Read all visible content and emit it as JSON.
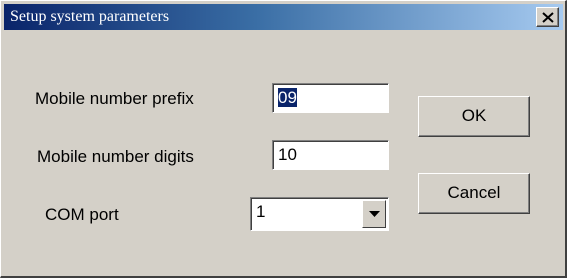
{
  "window": {
    "title": "Setup system parameters",
    "close_icon": "close-icon"
  },
  "fields": {
    "prefix": {
      "label": "Mobile number prefix",
      "value": "09"
    },
    "digits": {
      "label": "Mobile number digits",
      "value": "10"
    },
    "com_port": {
      "label": "COM port",
      "value": "1",
      "arrow_icon": "chevron-down-icon"
    }
  },
  "buttons": {
    "ok": "OK",
    "cancel": "Cancel"
  }
}
